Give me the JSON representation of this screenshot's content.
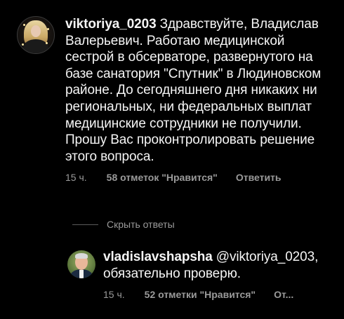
{
  "comments": [
    {
      "username": "viktoriya_0203",
      "text": "Здравствуйте, Владислав Валерьевич. Работаю медицинской сестрой в обсерваторе, развернутого на базе санатория \"Спутник\" в Людиновском районе. До сегодняшнего дня никаких ни региональных, ни федеральных выплат медицинские сотрудники не получили. Прошу Вас проконтролировать решение этого вопроса.",
      "time": "15 ч.",
      "likes": "58 отметок \"Нравится\"",
      "reply_label": "Ответить"
    }
  ],
  "hide_replies_label": "Скрыть ответы",
  "replies": [
    {
      "username": "vladislavshapsha",
      "text": "@viktoriya_0203, обязательно проверю.",
      "time": "15 ч.",
      "likes": "52 отметки \"Нравится\"",
      "reply_label": "От..."
    }
  ],
  "colors": {
    "background": "#000000",
    "text": "#f5f5f5",
    "secondary": "#9a9a9a"
  }
}
